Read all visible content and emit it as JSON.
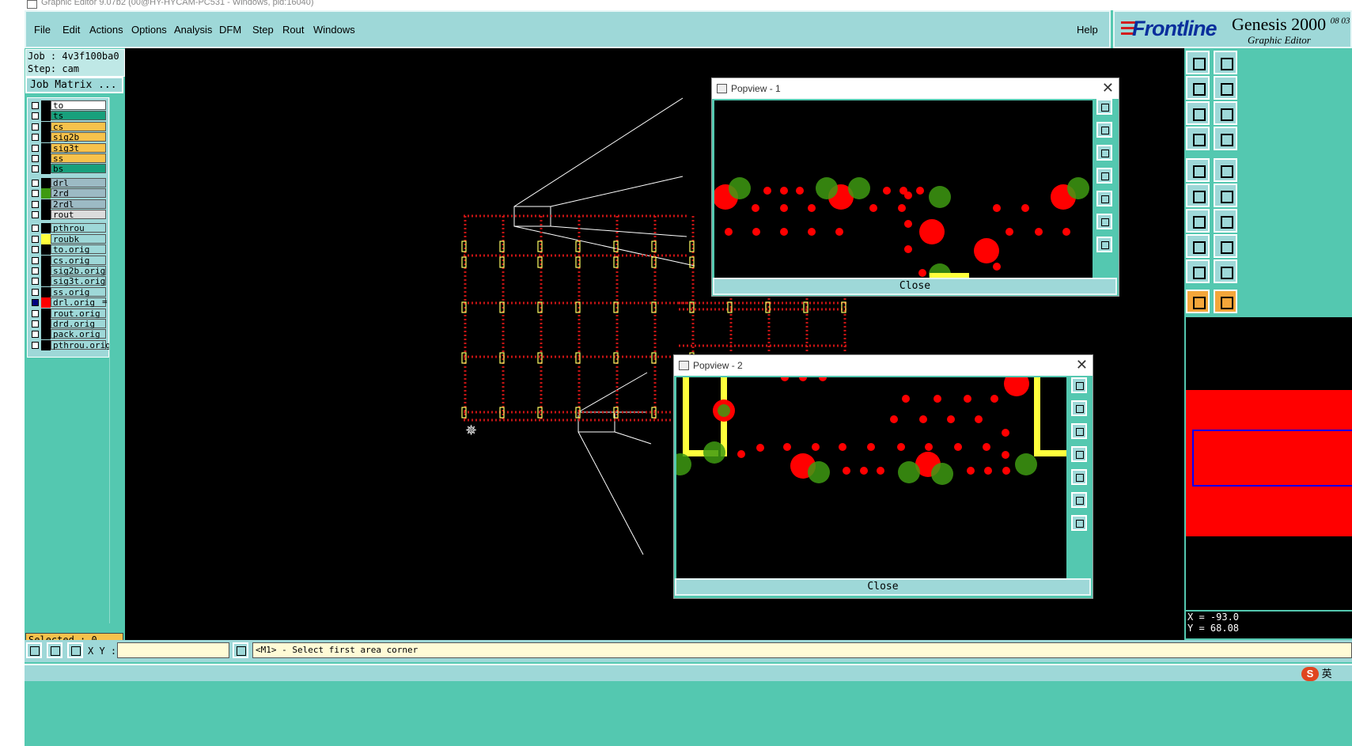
{
  "window": {
    "title": "Graphic Editor 9.07b2 (00@HY-HYCAM-PC531 - Windows, pid:16040)"
  },
  "menu": {
    "items": [
      "File",
      "Edit",
      "Actions",
      "Options",
      "Analysis",
      "DFM",
      "Step",
      "Rout",
      "Windows"
    ],
    "help": "Help"
  },
  "logo": {
    "brand": "Frontline",
    "product": "Genesis 2000",
    "version_fragment": "08 03",
    "subtitle": "Graphic Editor"
  },
  "job": {
    "job_line": "Job : 4v3f100ba0",
    "step_line": "Step: cam",
    "matrix_button": "Job Matrix ..."
  },
  "layers": [
    {
      "name": "to",
      "color": "#ffffff",
      "swatch": "#000000"
    },
    {
      "name": "ts",
      "color": "#18a07c",
      "swatch": "#000000"
    },
    {
      "name": "cs",
      "color": "#f6c24c",
      "swatch": "#000000"
    },
    {
      "name": "sig2b",
      "color": "#f6c24c",
      "swatch": "#000000"
    },
    {
      "name": "sig3t",
      "color": "#f6c24c",
      "swatch": "#000000"
    },
    {
      "name": "ss",
      "color": "#f6c24c",
      "swatch": "#000000"
    },
    {
      "name": "bs",
      "color": "#18a07c",
      "swatch": "#000000"
    },
    {
      "name": "drl",
      "color": "#9cbac4",
      "swatch": "#000000"
    },
    {
      "name": "2rd",
      "color": "#9cbac4",
      "swatch": "#3e9a12"
    },
    {
      "name": "2rdl",
      "color": "#9cbac4",
      "swatch": "#000000"
    },
    {
      "name": "rout",
      "color": "#dcdcdc",
      "swatch": "#000000"
    },
    {
      "name": "pthrou",
      "color": "#9ed8d8",
      "swatch": "#000000"
    },
    {
      "name": "roubk",
      "color": "#9ed8d8",
      "swatch": "#ffff3c"
    },
    {
      "name": "to.orig",
      "color": "#9ed8d8",
      "swatch": "#000000"
    },
    {
      "name": "cs.orig",
      "color": "#9ed8d8",
      "swatch": "#000000"
    },
    {
      "name": "sig2b.orig",
      "color": "#9ed8d8",
      "swatch": "#000000"
    },
    {
      "name": "sig3t.orig",
      "color": "#9ed8d8",
      "swatch": "#000000"
    },
    {
      "name": "ss.orig",
      "color": "#9ed8d8",
      "swatch": "#000000"
    },
    {
      "name": "drl.orig",
      "color": "#9ed8d8",
      "swatch": "#ff0000",
      "marker": "="
    },
    {
      "name": "rout.orig",
      "color": "#9ed8d8",
      "swatch": "#000000"
    },
    {
      "name": "drd.orig",
      "color": "#9ed8d8",
      "swatch": "#000000"
    },
    {
      "name": "pack.orig",
      "color": "#9ed8d8",
      "swatch": "#000000"
    },
    {
      "name": "pthrou.orig",
      "color": "#9ed8d8",
      "swatch": "#000000"
    }
  ],
  "selected": "Selected : 0",
  "popview1": {
    "title": "Popview - 1",
    "close": "Close"
  },
  "popview2": {
    "title": "Popview - 2",
    "close": "Close"
  },
  "coords": {
    "x": "X = -93.0",
    "y": "Y = 68.08"
  },
  "status": {
    "xy_label": "X Y :",
    "xy_value": "",
    "prompt": "<M1> - Select first area corner"
  },
  "ime": {
    "lang": "英"
  },
  "colors": {
    "panel": "#54c8b0",
    "menu": "#9ed8d8",
    "pad_red": "#ff0000",
    "pad_green": "#3e9a12",
    "trace_yellow": "#ffff3c"
  }
}
